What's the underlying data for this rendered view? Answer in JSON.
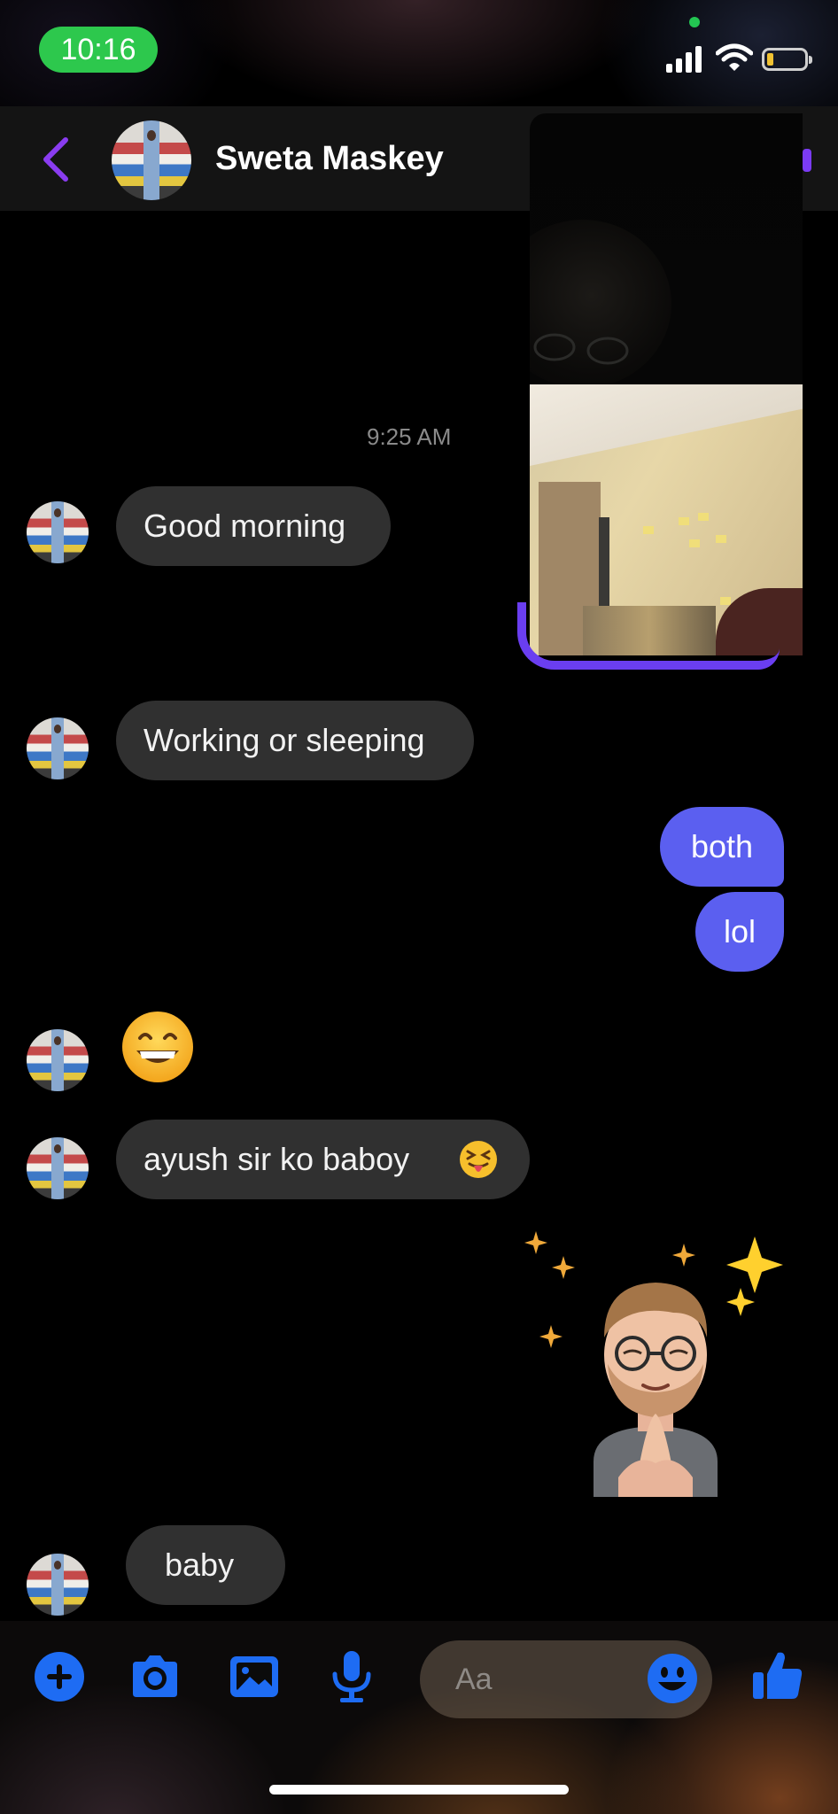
{
  "status_bar": {
    "time": "10:16"
  },
  "header": {
    "contact_name": "Sweta Maskey"
  },
  "messages": {
    "timestamp": "9:25 AM",
    "m1": "Good morning",
    "m2": "Working or sleeping",
    "m3": "both",
    "m4": "lol",
    "m5": "ayush sir ko baboy",
    "m6": "baby"
  },
  "composer": {
    "placeholder": "Aa"
  },
  "colors": {
    "outgoing_bubble": "#5b5ff0",
    "incoming_bubble": "#303030",
    "accent_blue": "#1e6cf3",
    "back_purple": "#8a3cf0",
    "status_green": "#2dc84d"
  },
  "icons": [
    "back-chevron-icon",
    "plus-icon",
    "camera-icon",
    "gallery-icon",
    "microphone-icon",
    "emoji-icon",
    "thumbs-up-icon"
  ]
}
